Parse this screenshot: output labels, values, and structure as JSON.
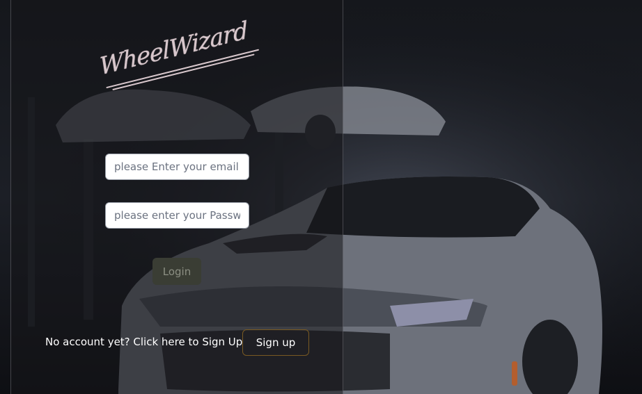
{
  "brand": {
    "logo_text": "WheelWizard"
  },
  "form": {
    "email_placeholder": "please Enter your email",
    "email_value": "",
    "password_placeholder": "please enter your Password",
    "password_value": "",
    "login_label": "Login"
  },
  "signup": {
    "prompt": "No account yet? Click here to Sign Up",
    "button_label": "Sign up"
  },
  "colors": {
    "logo": "#d8c7cc",
    "login_button_bg": "#3a3d34",
    "signup_border": "#7a5a22"
  }
}
